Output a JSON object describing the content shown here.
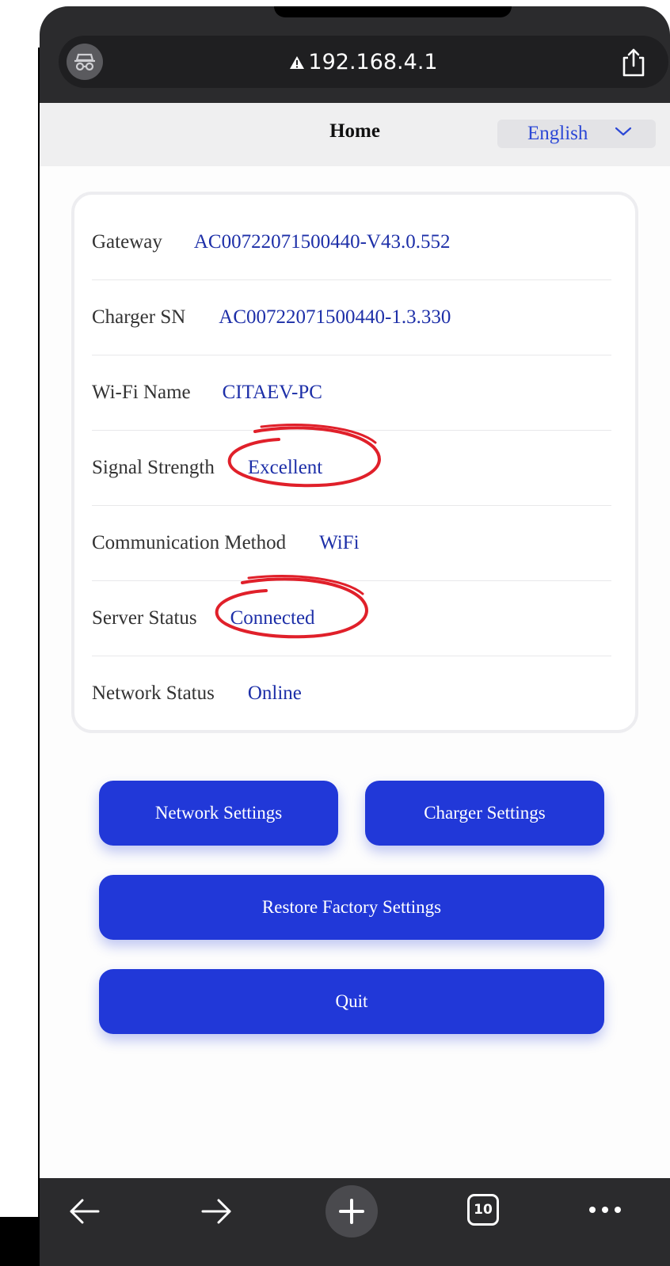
{
  "browser": {
    "url": "192.168.4.1",
    "tab_count": "10"
  },
  "header": {
    "title": "Home",
    "language": "English"
  },
  "info_rows": [
    {
      "label": "Gateway",
      "value": "AC00722071500440-V43.0.552"
    },
    {
      "label": "Charger SN",
      "value": "AC00722071500440-1.3.330"
    },
    {
      "label": "Wi-Fi Name",
      "value": "CITAEV-PC"
    },
    {
      "label": "Signal Strength",
      "value": "Excellent"
    },
    {
      "label": "Communication Method",
      "value": "WiFi"
    },
    {
      "label": "Server Status",
      "value": "Connected"
    },
    {
      "label": "Network Status",
      "value": "Online"
    }
  ],
  "buttons": {
    "network_settings": "Network Settings",
    "charger_settings": "Charger Settings",
    "restore_factory": "Restore Factory Settings",
    "quit": "Quit"
  },
  "colors": {
    "accent": "#2138d8",
    "value_text": "#1d2fa8",
    "annotation": "#e0202a",
    "browser_chrome": "#2b2b2d"
  },
  "icons": [
    "incognito-icon",
    "warning-icon",
    "share-icon",
    "chevron-down-icon",
    "back-arrow-icon",
    "forward-arrow-icon",
    "new-tab-plus-icon",
    "tabs-count-icon",
    "more-icon"
  ]
}
